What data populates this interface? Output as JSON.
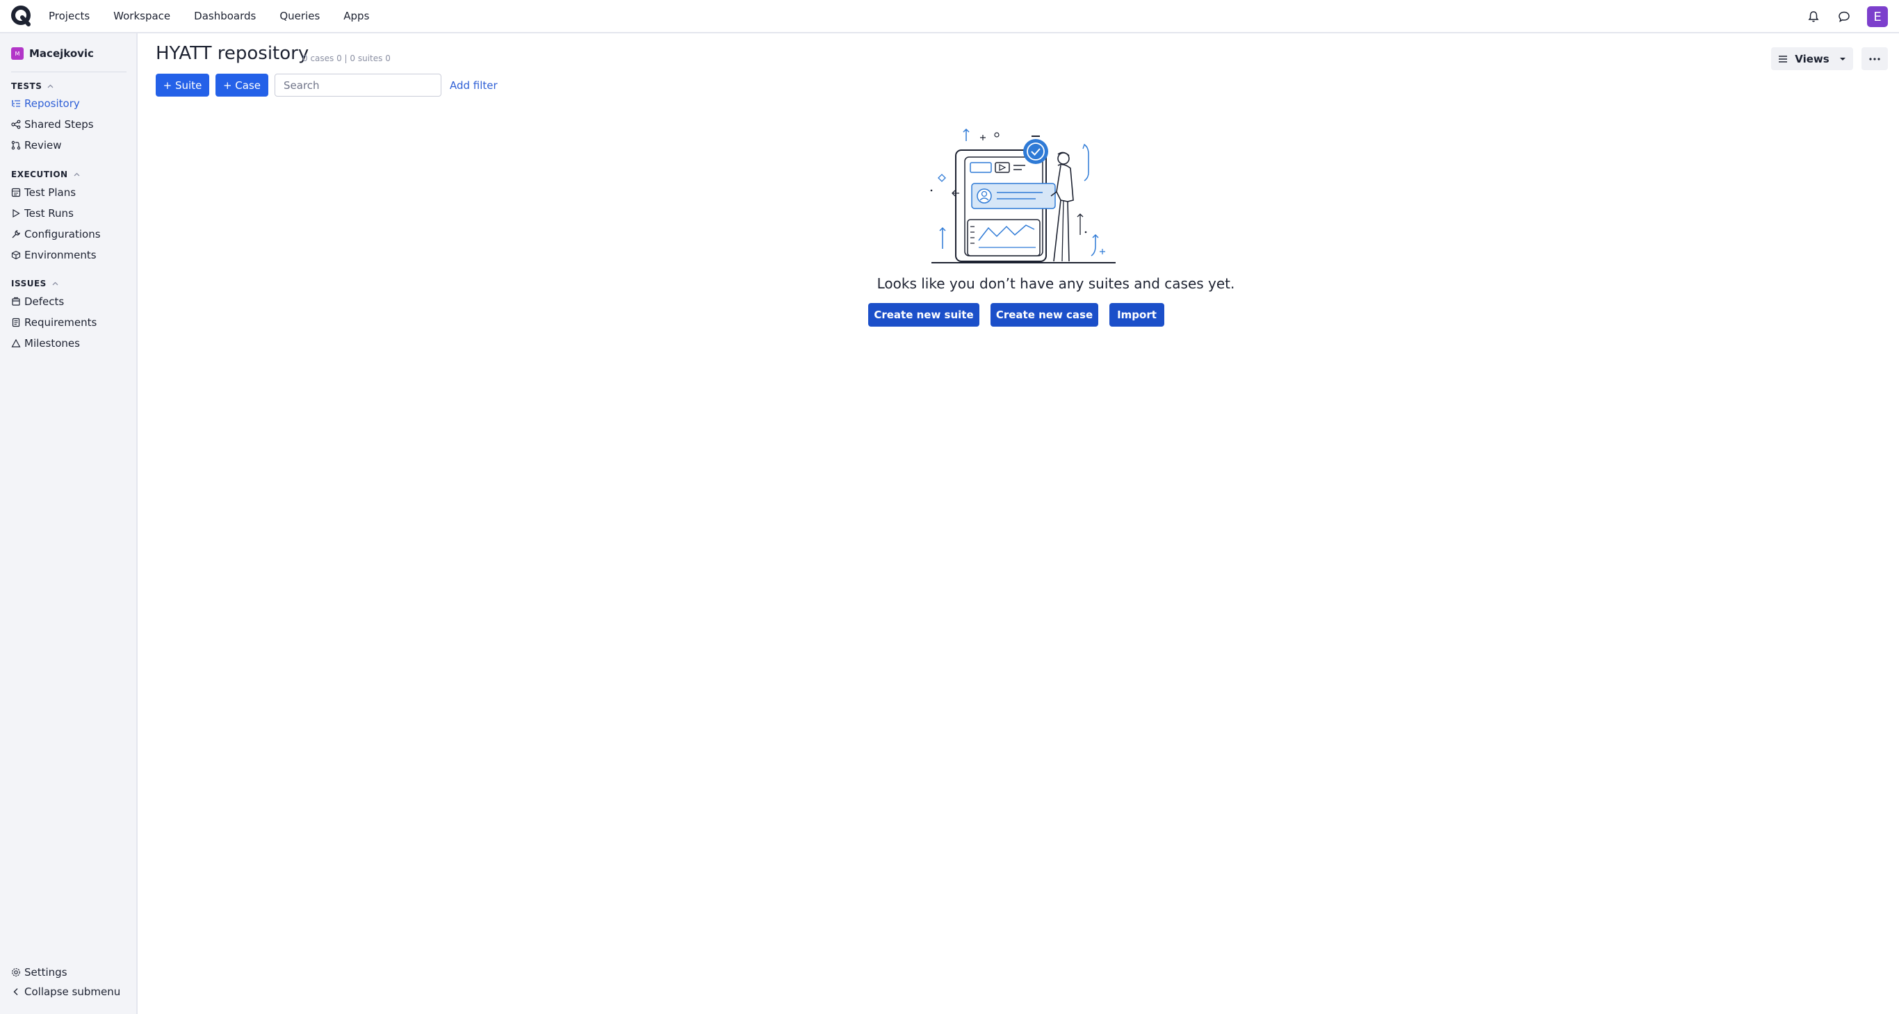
{
  "topnav": {
    "items": [
      "Projects",
      "Workspace",
      "Dashboards",
      "Queries",
      "Apps"
    ],
    "avatar_letter": "E"
  },
  "sidebar": {
    "project_badge": "M",
    "project_name": "Macejkovic",
    "sections": [
      {
        "title": "TESTS",
        "items": [
          "Repository",
          "Shared Steps",
          "Review"
        ]
      },
      {
        "title": "EXECUTION",
        "items": [
          "Test Plans",
          "Test Runs",
          "Configurations",
          "Environments"
        ]
      },
      {
        "title": "ISSUES",
        "items": [
          "Defects",
          "Requirements",
          "Milestones"
        ]
      }
    ],
    "active_item": "Repository",
    "settings_label": "Settings",
    "collapse_label": "Collapse submenu"
  },
  "main": {
    "title": "HYATT repository",
    "counts": "0 cases 0 | 0 suites 0",
    "suite_button": "+ Suite",
    "case_button": "+ Case",
    "search_placeholder": "Search",
    "add_filter": "Add filter",
    "views_label": "Views",
    "empty_message": "Looks like you don’t have any suites and cases yet.",
    "create_suite": "Create new suite",
    "create_case": "Create new case",
    "import": "Import"
  },
  "colors": {
    "primary": "#2461e8",
    "primary_dark": "#1b4fc9",
    "avatar": "#7c3fcc",
    "project_badge": "#b235c8",
    "link": "#2e5fd6"
  }
}
